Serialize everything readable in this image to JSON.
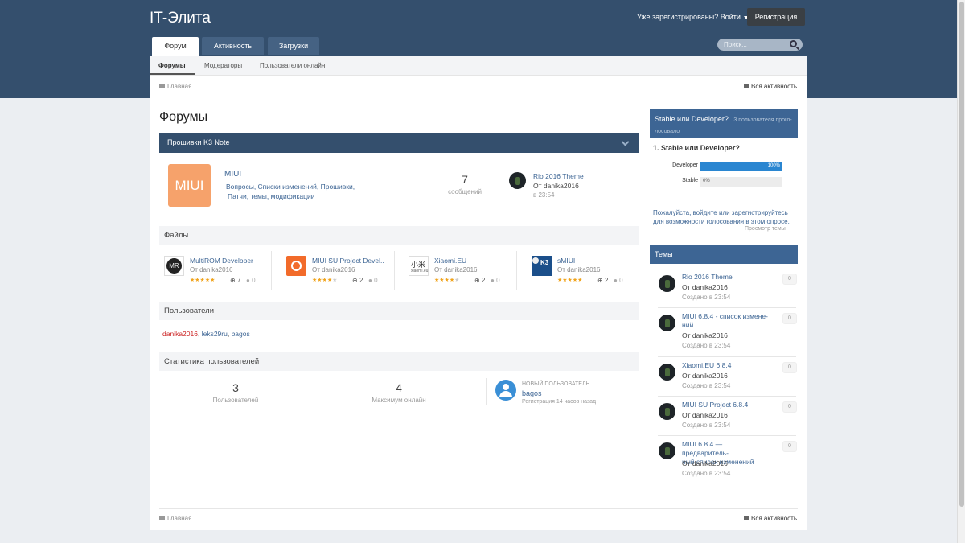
{
  "header": {
    "brand": "IT-Элита",
    "signin": "Уже зарегистрированы? Войти",
    "register": "Регистрация",
    "tabs": [
      "Форум",
      "Активность",
      "Загрузки"
    ],
    "search_placeholder": "Поиск..."
  },
  "subnav": [
    "Форумы",
    "Модераторы",
    "Пользователи онлайн"
  ],
  "breadcrumb": {
    "home": "Главная",
    "all_activity": "Вся активность"
  },
  "page_title": "Форумы",
  "category": "Прошивки K3 Note",
  "forum": {
    "icon_text": "MIUI",
    "title": "MIUI",
    "subforums": "Вопросы,  Списки изменений,  Прошивки,",
    "subforums2": "Патчи, темы, модификации",
    "count": "7",
    "count_label": "сообщений",
    "last_title": "Rio 2016 Theme",
    "last_by": "От danika2016",
    "last_date": "в 23:54"
  },
  "files_header": "Файлы",
  "files": [
    {
      "name": "MultiROM Developer",
      "by": "От danika2016",
      "dl": "7",
      "comments": "0",
      "rating": 5
    },
    {
      "name": "MIUI SU Project Devel...",
      "by": "От danika2016",
      "dl": "2",
      "comments": "0",
      "rating": 4
    },
    {
      "name": "Xiaomi.EU",
      "by": "От danika2016",
      "dl": "2",
      "comments": "0",
      "rating": 4
    },
    {
      "name": "sMIUI",
      "by": "От danika2016",
      "dl": "2",
      "comments": "0",
      "rating": 5
    }
  ],
  "users_header": "Пользователи",
  "users": [
    "danika2016",
    "leks29ru",
    "bagos"
  ],
  "stats_header": "Статистика пользователей",
  "stats": {
    "users": "3",
    "users_label": "Пользователей",
    "max": "4",
    "max_label": "Максимум онлайн",
    "new_label": "НОВЫЙ ПОЛЬЗОВАТЕЛЬ",
    "new_name": "bagos",
    "new_date": "Регистрация 14 часов назад"
  },
  "poll": {
    "title": "Stable или Developer?",
    "votes": "3 пользователя прого-",
    "votes2": "лосовало",
    "question": "1. Stable или Developer?",
    "options": [
      {
        "label": "Developer",
        "pct": 100,
        "text": "100%"
      },
      {
        "label": "Stable",
        "pct": 0,
        "text": "0%"
      }
    ],
    "note": "Пожалуйста, войдите или зарегистрируйтесь для возможности голосования в этом опросе.",
    "view": "Просмотр темы"
  },
  "topics_header": "Темы",
  "topics": [
    {
      "title": "Rio 2016 Theme",
      "by": "От danika2016",
      "date": "Создано в 23:54",
      "count": "0"
    },
    {
      "title": "MIUI 6.8.4 - список измене-",
      "title2": "ний",
      "by": "От danika2016",
      "date": "Создано в 23:54",
      "count": "0"
    },
    {
      "title": "Xiaomi.EU 6.8.4",
      "by": "От danika2016",
      "date": "Создано в 23:54",
      "count": "0"
    },
    {
      "title": "MIUI SU Project 6.8.4",
      "by": "От danika2016",
      "date": "Создано в 23:54",
      "count": "0"
    },
    {
      "title": "MIUI 6.8.4 — предваритель-",
      "title2": "ный список изменений",
      "by": "От danika2016",
      "date": "Создано в 23:54",
      "count": "0"
    }
  ],
  "colors": {
    "header": "#344f6d",
    "accent": "#3d6594",
    "bar": "#2a86d1",
    "star": "#f0a31b"
  }
}
